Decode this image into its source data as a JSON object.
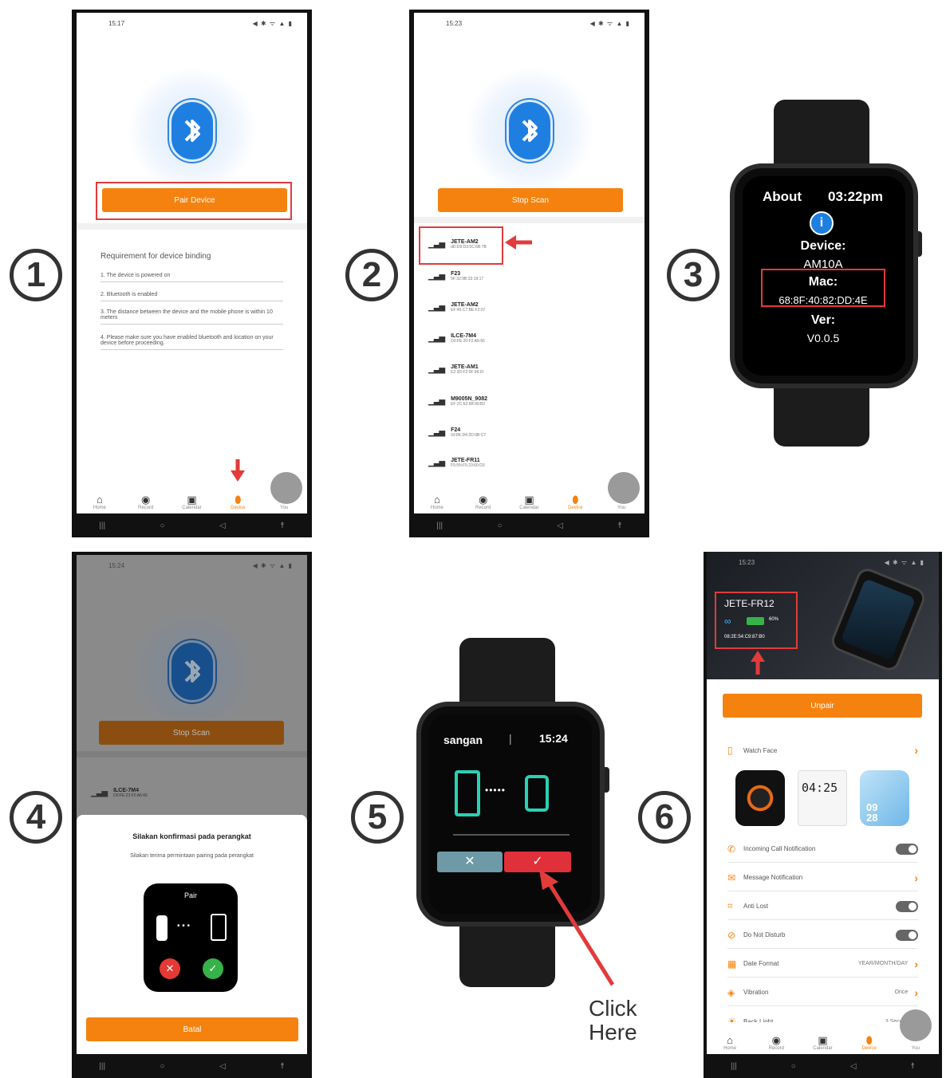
{
  "steps": [
    "1",
    "2",
    "3",
    "4",
    "5",
    "6"
  ],
  "status": {
    "p1_time": "15:17",
    "p2_time": "15:23",
    "p4_time": "15:24",
    "p6_time": "15:23",
    "icons": "◀ ✱ ᯤ ▲ ▮"
  },
  "p1": {
    "pair_button": "Pair Device",
    "req_title": "Requirement for device binding",
    "reqs": [
      "1. The device is powered on",
      "2. Bluetooth is enabled",
      "3. The distance between the device and the mobile phone is within 10 meters",
      "4. Please make sure you have enabled bluetooth and location on your device before proceeding."
    ]
  },
  "tabs": [
    "Home",
    "Record",
    "Calendar",
    "Device",
    "You"
  ],
  "p2": {
    "stop_button": "Stop Scan",
    "devices": [
      {
        "name": "JETE-AM2",
        "mac": "dD:D9:D3:5C:6B:7B"
      },
      {
        "name": "F23",
        "mac": "5F:32:9B:33:19:17"
      },
      {
        "name": "JETE-AM2",
        "mac": "EF:45:C7:BE:F2:07"
      },
      {
        "name": "ILCE-7M4",
        "mac": "D0:FE:20:F2:A6:66"
      },
      {
        "name": "JETE-AM1",
        "mac": "E2:3D:F2:0F:96:0I"
      },
      {
        "name": "M9005N_9082",
        "mac": "EF:2C:62:6B:90:B2"
      },
      {
        "name": "F24",
        "mac": "93:8K:D4:2D:0B:C7"
      },
      {
        "name": "JETE-FR11",
        "mac": "F5:5N:F5:23:60:D3"
      }
    ]
  },
  "watch3": {
    "title": "About",
    "time": "03:22pm",
    "info_icon": "i",
    "device_label": "Device:",
    "device": "AM10A",
    "mac_label": "Mac:",
    "mac": "68:8F:40:82:DD:4E",
    "ver_label": "Ver:",
    "ver": "V0.0.5"
  },
  "p4": {
    "stop_button": "Stop Scan",
    "device": {
      "name": "ILCE-7M4",
      "mac": "D0:FE:23:F2:A6:66"
    },
    "dialog_title": "Silakan konfirmasi pada perangkat",
    "dialog_sub": "Silakan terima permintaan pairing pada perangkat",
    "pair_label": "Pair",
    "cancel_button": "Batal"
  },
  "watch5": {
    "name": "sangan",
    "sep": "|",
    "time": "15:24",
    "click_here": "Click\nHere"
  },
  "p6": {
    "device_name": "JETE-FR12",
    "battery": "60%",
    "mac": "08:2E:54:C9:87:B0",
    "unpair": "Unpair",
    "watch_face": "Watch Face",
    "face2_time": "04:25",
    "face3_time": "09 28",
    "settings": [
      {
        "label": "Incoming Call Notification",
        "type": "toggle"
      },
      {
        "label": "Message Notification",
        "type": "chevron"
      },
      {
        "label": "Anti Lost",
        "type": "toggle"
      },
      {
        "label": "Do Not Disturb",
        "type": "toggle"
      },
      {
        "label": "Date Format",
        "value": "YEAR/MONTH/DAY",
        "type": "chevron"
      },
      {
        "label": "Vibration",
        "value": "Once",
        "type": "chevron"
      },
      {
        "label": "Back Light",
        "value": "3 Seconds",
        "type": "none"
      }
    ]
  }
}
